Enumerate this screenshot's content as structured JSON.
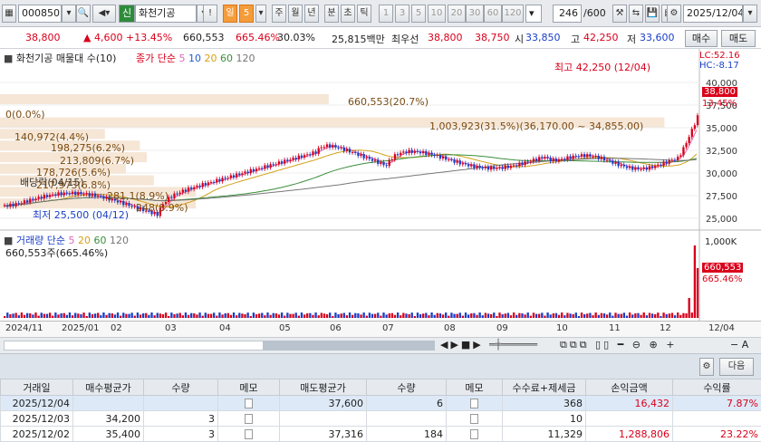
{
  "toolbar": {
    "code": "000850",
    "market_badge": "신",
    "stock_name": "화천기공",
    "bang": "!",
    "period_active": "일",
    "period_num": "5",
    "periods": [
      "주",
      "월",
      "년",
      "분",
      "초",
      "틱"
    ],
    "intervals": [
      "1",
      "3",
      "5",
      "10",
      "20",
      "30",
      "60",
      "120"
    ],
    "count": "246",
    "count_total": "/600",
    "date": "2025/12/04"
  },
  "price": {
    "current": "38,800",
    "change": "▲ 4,600",
    "change_pct": "+13.45%",
    "volume": "660,553",
    "volume_pct": "665.46%",
    "turnover_pct": "30.03%",
    "amount": "25,815백만",
    "best_ask_label": "최우선",
    "best_ask": "38,800",
    "best_bid": "38,750",
    "open_label": "시",
    "open": "33,850",
    "high_label": "고",
    "high": "42,250",
    "low_label": "저",
    "low": "33,600",
    "sell_button": "매수",
    "buy_button": "매도"
  },
  "chart": {
    "legend_title": "화천기공 매물대 수(10)",
    "ma_label": "종가 단순",
    "ma_periods": [
      "5",
      "10",
      "20",
      "60",
      "120"
    ],
    "lc": "LC:52.16",
    "hc": "HC:-8.17",
    "high_note": "최고 42,250 (12/04)",
    "low_note": "최저 25,500 (04/12)",
    "dividend": "배당락(04/15)",
    "current_tag": "38,800",
    "current_pct": "13.45%",
    "profile": [
      {
        "label": "660,553(20.7%)"
      },
      {
        "label": "0(0.0%)"
      },
      {
        "label": "1,003,923(31.5%)(36,170.00 ~ 34,855.00)"
      },
      {
        "label": "140,972(4.4%)"
      },
      {
        "label": "198,275(6.2%)"
      },
      {
        "label": "213,809(6.7%)"
      },
      {
        "label": "178,726(5.6%)"
      },
      {
        "label": "217,973(6.8%)"
      },
      {
        "label": "281,1(8.9%)"
      },
      {
        "label": "248(8.9%)"
      }
    ],
    "y_ticks": [
      "40,000",
      "37,500",
      "35,000",
      "32,500",
      "30,000",
      "27,500",
      "25,000"
    ],
    "vol_title": "거래량 단순",
    "vol_ma": [
      "5",
      "20",
      "60",
      "120"
    ],
    "vol_value": "660,553주(665.46%)",
    "vol_tick": "1,000K",
    "vol_tag": "660,553",
    "vol_tag_pct": "665.46%",
    "x_labels": [
      "2024/11",
      "2025/01",
      "02",
      "03",
      "04",
      "05",
      "06",
      "07",
      "08",
      "09",
      "10",
      "11",
      "12",
      "12/04"
    ]
  },
  "panel": {
    "next_button": "다음"
  },
  "table": {
    "headers": [
      "거래일",
      "매수평균가",
      "수량",
      "메모",
      "매도평균가",
      "수량",
      "메모",
      "수수료+제세금",
      "손익금액",
      "수익률"
    ],
    "rows": [
      {
        "date": "2025/12/04",
        "buy_avg": "",
        "buy_qty": "",
        "sell_avg": "37,600",
        "sell_qty": "6",
        "fee": "368",
        "pnl": "16,432",
        "ret": "7.87%"
      },
      {
        "date": "2025/12/03",
        "buy_avg": "34,200",
        "buy_qty": "3",
        "sell_avg": "",
        "sell_qty": "",
        "fee": "10",
        "pnl": "",
        "ret": ""
      },
      {
        "date": "2025/12/02",
        "buy_avg": "35,400",
        "buy_qty": "3",
        "sell_avg": "37,316",
        "sell_qty": "184",
        "fee": "11,329",
        "pnl": "1,288,806",
        "ret": "23.22%"
      }
    ]
  },
  "colors": {
    "up": "#d9001b",
    "down": "#1a3fc7",
    "ma5": "#e06ab8",
    "ma10": "#1f5fd6",
    "ma20": "#d4a017",
    "ma60": "#3a8e3a",
    "ma120": "#777777",
    "profile": "#f5e6d6"
  }
}
